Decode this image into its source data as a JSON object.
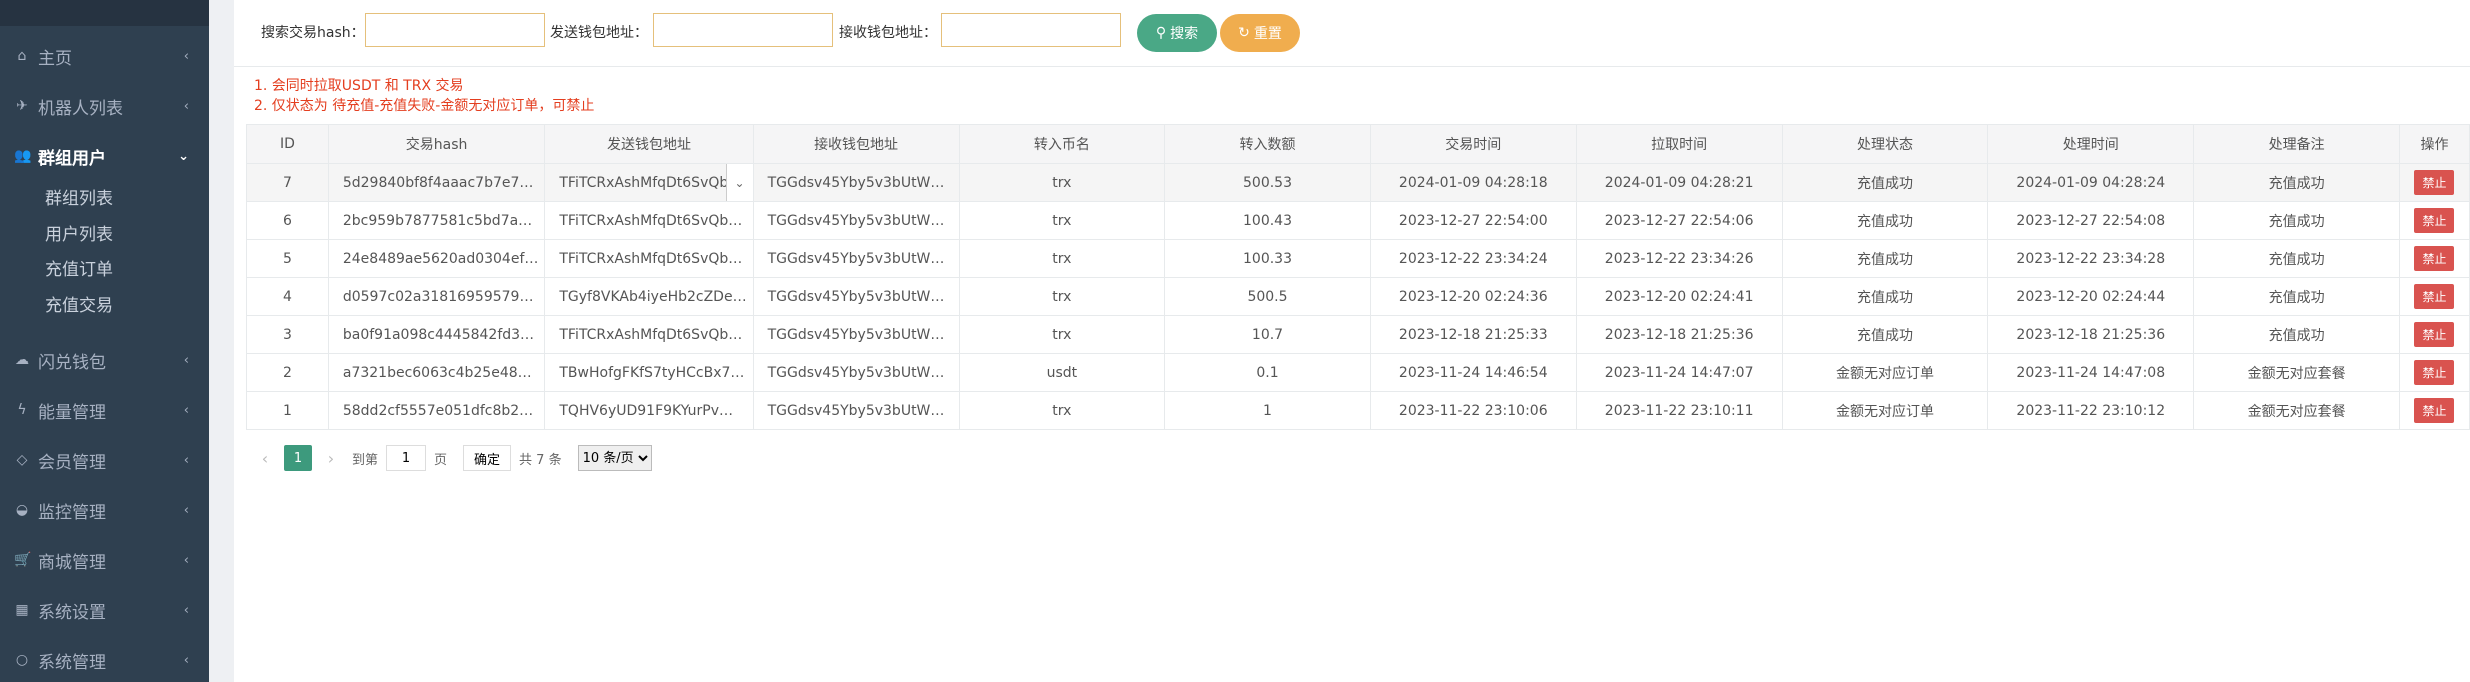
{
  "sidebar": {
    "menu": [
      {
        "label": "主页",
        "icon": "home-icon",
        "glyph": "⌂",
        "arrow": "‹"
      },
      {
        "label": "机器人列表",
        "icon": "plane-icon",
        "glyph": "✈",
        "arrow": "‹"
      },
      {
        "label": "群组用户",
        "icon": "users-icon",
        "glyph": "👥",
        "arrow": "⌄"
      },
      {
        "label": "闪兑钱包",
        "icon": "cloud-icon",
        "glyph": "☁",
        "arrow": "‹"
      },
      {
        "label": "能量管理",
        "icon": "bolt-icon",
        "glyph": "ϟ",
        "arrow": "‹"
      },
      {
        "label": "会员管理",
        "icon": "diamond-icon",
        "glyph": "◇",
        "arrow": "‹"
      },
      {
        "label": "监控管理",
        "icon": "dashboard-icon",
        "glyph": "◒",
        "arrow": "‹"
      },
      {
        "label": "商城管理",
        "icon": "cart-icon",
        "glyph": "🛒",
        "arrow": "‹"
      },
      {
        "label": "系统设置",
        "icon": "windows-icon",
        "glyph": "▦",
        "arrow": "‹"
      },
      {
        "label": "系统管理",
        "icon": "circle-icon",
        "glyph": "○",
        "arrow": "‹"
      }
    ],
    "submenu": [
      "群组列表",
      "用户列表",
      "充值订单",
      "充值交易"
    ]
  },
  "search": {
    "hash_label": "搜索交易hash：",
    "send_label": "发送钱包地址：",
    "recv_label": "接收钱包地址：",
    "search_button": "搜索",
    "reset_button": "重置"
  },
  "notes": [
    "1. 会同时拉取USDT 和 TRX 交易",
    "2. 仅状态为 待充值-充值失败-金额无对应订单，可禁止"
  ],
  "table": {
    "headers": [
      "ID",
      "交易hash",
      "发送钱包地址",
      "接收钱包地址",
      "转入币名",
      "转入数额",
      "交易时间",
      "拉取时间",
      "处理状态",
      "处理时间",
      "处理备注",
      "操作"
    ],
    "rows": [
      [
        "7",
        "5d29840bf8f4aaac7b7e7…",
        "TFiTCRxAshMfqDt6SvQb…",
        "TGGdsv45Yby5v3bUtW…",
        "trx",
        "500.53",
        "2024-01-09 04:28:18",
        "2024-01-09 04:28:21",
        "充值成功",
        "2024-01-09 04:28:24",
        "充值成功",
        "禁止"
      ],
      [
        "6",
        "2bc959b7877581c5bd7a…",
        "TFiTCRxAshMfqDt6SvQb…",
        "TGGdsv45Yby5v3bUtW…",
        "trx",
        "100.43",
        "2023-12-27 22:54:00",
        "2023-12-27 22:54:06",
        "充值成功",
        "2023-12-27 22:54:08",
        "充值成功",
        "禁止"
      ],
      [
        "5",
        "24e8489ae5620ad0304ef…",
        "TFiTCRxAshMfqDt6SvQb…",
        "TGGdsv45Yby5v3bUtW…",
        "trx",
        "100.33",
        "2023-12-22 23:34:24",
        "2023-12-22 23:34:26",
        "充值成功",
        "2023-12-22 23:34:28",
        "充值成功",
        "禁止"
      ],
      [
        "4",
        "d0597c02a31816959579…",
        "TGyf8VKAb4iyeHb2cZDe…",
        "TGGdsv45Yby5v3bUtW…",
        "trx",
        "500.5",
        "2023-12-20 02:24:36",
        "2023-12-20 02:24:41",
        "充值成功",
        "2023-12-20 02:24:44",
        "充值成功",
        "禁止"
      ],
      [
        "3",
        "ba0f91a098c4445842fd3…",
        "TFiTCRxAshMfqDt6SvQb…",
        "TGGdsv45Yby5v3bUtW…",
        "trx",
        "10.7",
        "2023-12-18 21:25:33",
        "2023-12-18 21:25:36",
        "充值成功",
        "2023-12-18 21:25:36",
        "充值成功",
        "禁止"
      ],
      [
        "2",
        "a7321bec6063c4b25e48…",
        "TBwHofgFKfS7tyHCcBx7…",
        "TGGdsv45Yby5v3bUtW…",
        "usdt",
        "0.1",
        "2023-11-24 14:46:54",
        "2023-11-24 14:47:07",
        "金额无对应订单",
        "2023-11-24 14:47:08",
        "金额无对应套餐",
        "禁止"
      ],
      [
        "1",
        "58dd2cf5557e051dfc8b2…",
        "TQHV6yUD91F9KYurPv…",
        "TGGdsv45Yby5v3bUtW…",
        "trx",
        "1",
        "2023-11-22 23:10:06",
        "2023-11-22 23:10:11",
        "金额无对应订单",
        "2023-11-22 23:10:12",
        "金额无对应套餐",
        "禁止"
      ]
    ]
  },
  "pager": {
    "prev": "‹",
    "current": "1",
    "next": "›",
    "goto_label": "到第",
    "page_value": "1",
    "page_unit": "页",
    "confirm": "确定",
    "total": "共 7 条",
    "per_page": "10 条/页"
  },
  "colors": {
    "sidebar_bg": "#2f4050",
    "search_button": "#4aa886",
    "reset_button": "#f0ad4e",
    "ban_button": "#d9534f",
    "note_text": "#e43e1f",
    "pager_active": "#3d9a7d"
  }
}
